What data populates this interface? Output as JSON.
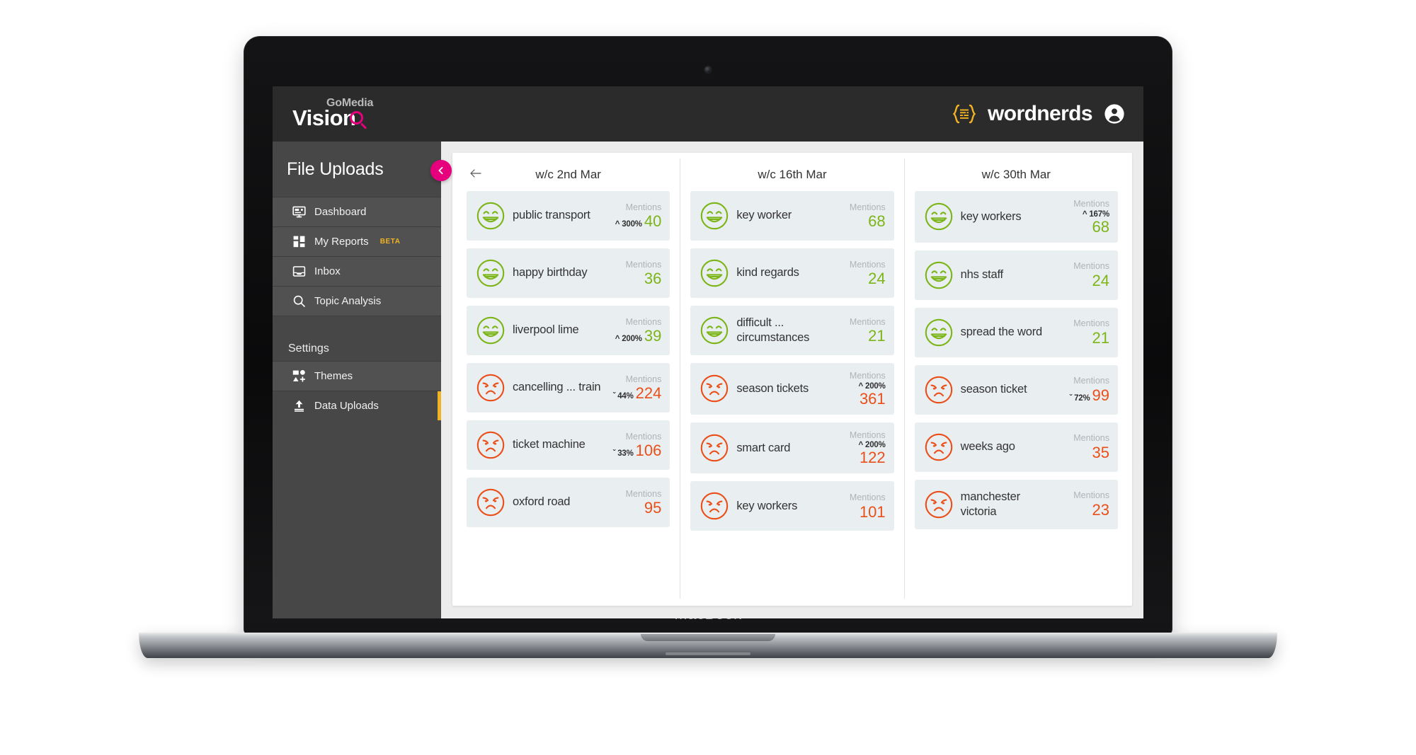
{
  "device": {
    "wordmark": "MacBook"
  },
  "topbar": {
    "logo": {
      "gomedia": "GoMedia",
      "vision": "Vision"
    },
    "brand": {
      "name": "wordnerds",
      "icon": "braces-lines-icon",
      "avatar_icon": "account-circle-icon"
    }
  },
  "sidebar": {
    "title": "File Uploads",
    "collapse_icon": "chevron-left-icon",
    "accent_color": "#e6007e",
    "items": [
      {
        "label": "Dashboard",
        "icon": "dashboard-icon",
        "badge": "",
        "active": false
      },
      {
        "label": "My Reports",
        "icon": "grid-icon",
        "badge": "BETA",
        "active": false
      },
      {
        "label": "Inbox",
        "icon": "inbox-icon",
        "badge": "",
        "active": false
      },
      {
        "label": "Topic Analysis",
        "icon": "search-icon",
        "badge": "",
        "active": false
      }
    ],
    "section_label": "Settings",
    "settings_items": [
      {
        "label": "Themes",
        "icon": "themes-icon",
        "active": true,
        "accent": false
      },
      {
        "label": "Data Uploads",
        "icon": "upload-icon",
        "active": false,
        "accent": true
      }
    ],
    "accent_bar_color": "#f0b323"
  },
  "main": {
    "back_icon": "arrow-left-icon",
    "mentions_label": "Mentions",
    "positive_color": "#7cb518",
    "negative_color": "#ea4f19",
    "columns": [
      {
        "heading": "w/c 2nd Mar",
        "has_back": true,
        "cards": [
          {
            "term": "public transport",
            "sentiment": "positive",
            "percent": "300%",
            "direction": "up",
            "mentions": "40",
            "layout": "inline"
          },
          {
            "term": "happy birthday",
            "sentiment": "positive",
            "percent": "",
            "direction": "",
            "mentions": "36",
            "layout": "inline"
          },
          {
            "term": "liverpool lime",
            "sentiment": "positive",
            "percent": "200%",
            "direction": "up",
            "mentions": "39",
            "layout": "inline"
          },
          {
            "term": "cancelling ... train",
            "sentiment": "negative",
            "percent": "44%",
            "direction": "down",
            "mentions": "224",
            "layout": "inline"
          },
          {
            "term": "ticket machine",
            "sentiment": "negative",
            "percent": "33%",
            "direction": "down",
            "mentions": "106",
            "layout": "inline"
          },
          {
            "term": "oxford road",
            "sentiment": "negative",
            "percent": "",
            "direction": "",
            "mentions": "95",
            "layout": "inline"
          }
        ]
      },
      {
        "heading": "w/c 16th Mar",
        "has_back": false,
        "cards": [
          {
            "term": "key worker",
            "sentiment": "positive",
            "percent": "",
            "direction": "",
            "mentions": "68",
            "layout": "inline"
          },
          {
            "term": "kind regards",
            "sentiment": "positive",
            "percent": "",
            "direction": "",
            "mentions": "24",
            "layout": "inline"
          },
          {
            "term": "difficult ... circumstances",
            "sentiment": "positive",
            "percent": "",
            "direction": "",
            "mentions": "21",
            "layout": "inline"
          },
          {
            "term": "season tickets",
            "sentiment": "negative",
            "percent": "200%",
            "direction": "up",
            "mentions": "361",
            "layout": "stacked"
          },
          {
            "term": "smart card",
            "sentiment": "negative",
            "percent": "200%",
            "direction": "up",
            "mentions": "122",
            "layout": "stacked"
          },
          {
            "term": "key workers",
            "sentiment": "negative",
            "percent": "",
            "direction": "",
            "mentions": "101",
            "layout": "inline"
          }
        ]
      },
      {
        "heading": "w/c 30th Mar",
        "has_back": false,
        "cards": [
          {
            "term": "key workers",
            "sentiment": "positive",
            "percent": "167%",
            "direction": "up",
            "mentions": "68",
            "layout": "stacked"
          },
          {
            "term": "nhs staff",
            "sentiment": "positive",
            "percent": "",
            "direction": "",
            "mentions": "24",
            "layout": "inline"
          },
          {
            "term": "spread the word",
            "sentiment": "positive",
            "percent": "",
            "direction": "",
            "mentions": "21",
            "layout": "inline"
          },
          {
            "term": "season ticket",
            "sentiment": "negative",
            "percent": "72%",
            "direction": "down",
            "mentions": "99",
            "layout": "inline"
          },
          {
            "term": "weeks ago",
            "sentiment": "negative",
            "percent": "",
            "direction": "",
            "mentions": "35",
            "layout": "inline"
          },
          {
            "term": "manchester victoria",
            "sentiment": "negative",
            "percent": "",
            "direction": "",
            "mentions": "23",
            "layout": "inline"
          }
        ]
      }
    ]
  }
}
